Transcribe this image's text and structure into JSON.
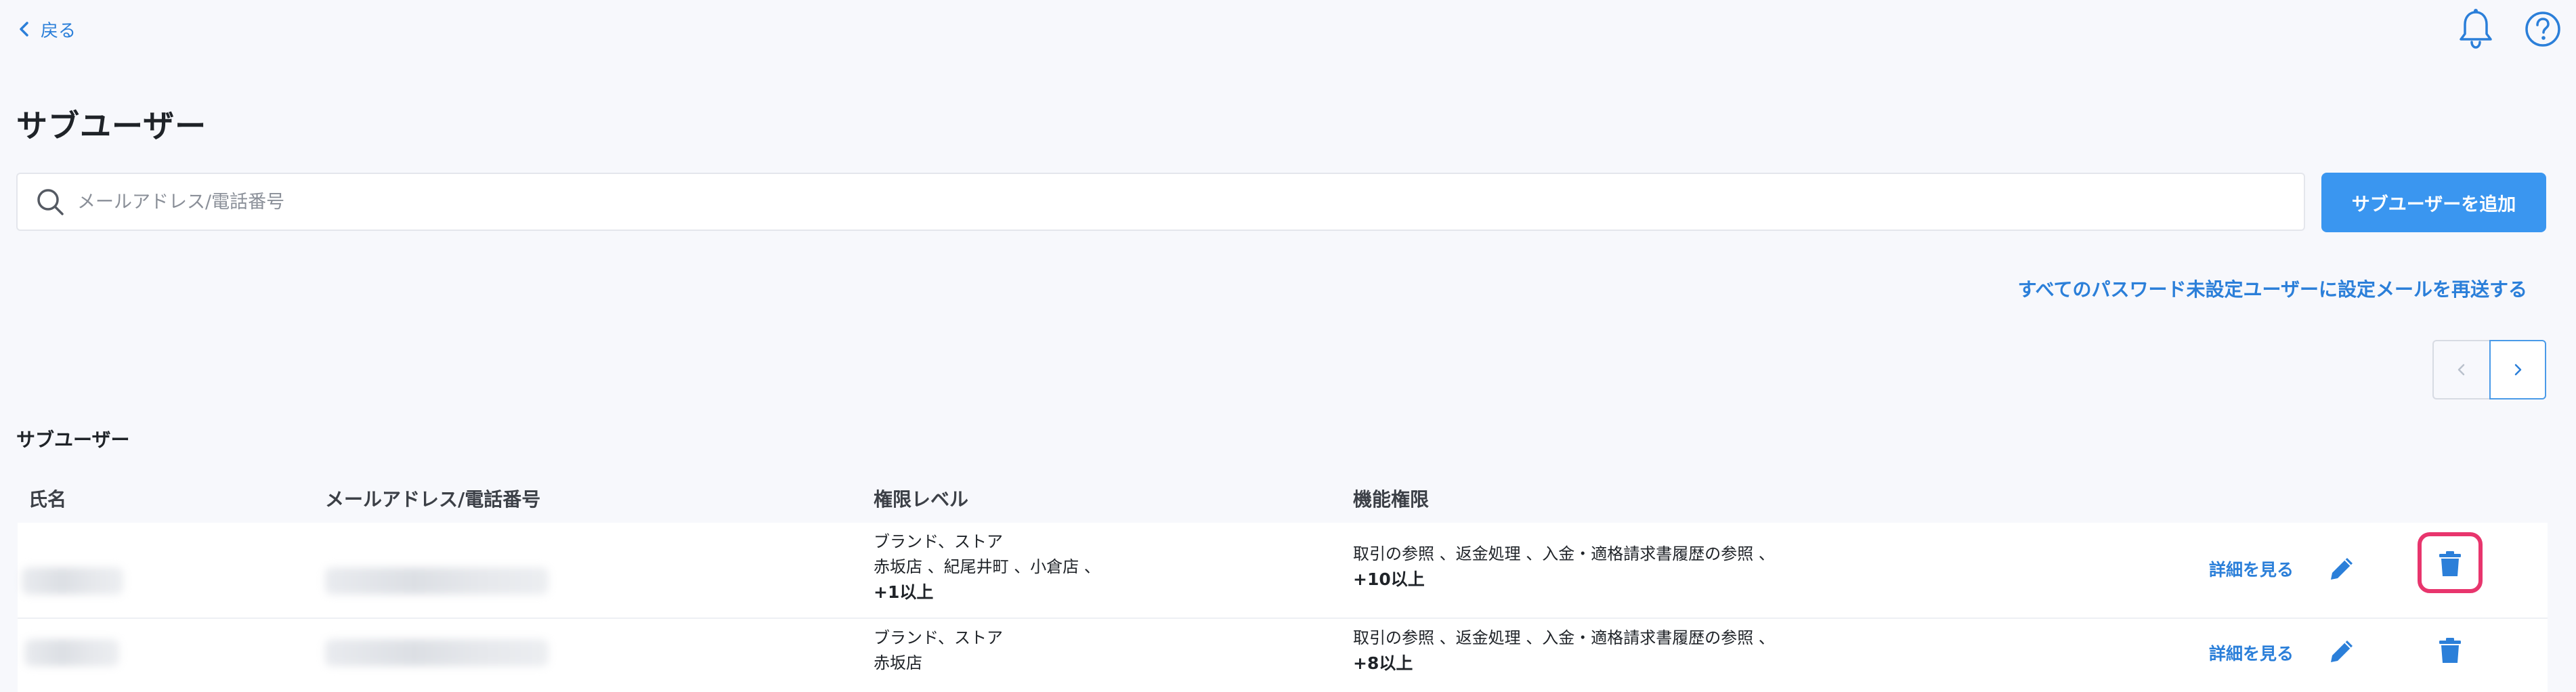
{
  "nav": {
    "back_label": "戻る"
  },
  "icons": {
    "back": "chevron-left-icon",
    "bell": "bell-icon",
    "help": "help-circle-icon",
    "search": "search-icon",
    "edit": "pencil-icon",
    "delete": "trash-icon"
  },
  "page": {
    "title": "サブユーザー"
  },
  "search": {
    "placeholder": "メールアドレス/電話番号",
    "value": ""
  },
  "actions": {
    "add_label": "サブユーザーを追加",
    "resend_label": "すべてのパスワード未設定ユーザーに設定メールを再送する"
  },
  "section": {
    "title": "サブユーザー"
  },
  "table": {
    "headers": {
      "name": "氏名",
      "email": "メールアドレス/電話番号",
      "level": "権限レベル",
      "function": "機能権限"
    },
    "rows": [
      {
        "name": "",
        "email": "",
        "level_line1": "ブランド、ストア",
        "level_line2": "赤坂店 、紀尾井町 、小倉店 、",
        "level_more": "+1以上",
        "function_line1": "取引の参照 、返金処理 、入金・適格請求書履歴の参照 、",
        "function_more": "+10以上",
        "detail_label": "詳細を見る"
      },
      {
        "name": "",
        "email": "",
        "level_line1": "ブランド、ストア",
        "level_line2": "赤坂店",
        "function_line1": "取引の参照 、返金処理 、入金・適格請求書履歴の参照 、",
        "function_more": "+8以上",
        "detail_label": "詳細を見る"
      }
    ]
  },
  "colors": {
    "accent": "#3a96f0",
    "link": "#2b7fd9",
    "highlight": "#e8356d",
    "background": "#f7f8fc"
  }
}
